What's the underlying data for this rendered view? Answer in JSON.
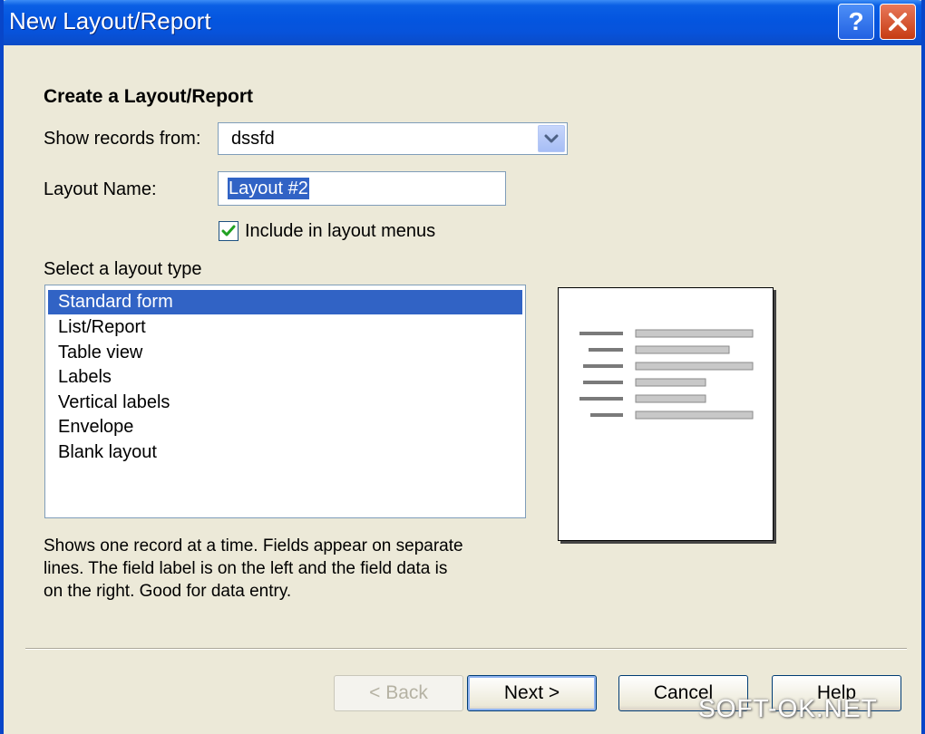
{
  "window": {
    "title": "New Layout/Report",
    "help_button": "?",
    "close_button": "X"
  },
  "form": {
    "heading": "Create a Layout/Report",
    "show_records_label": "Show records from:",
    "show_records_value": "dssfd",
    "layout_name_label": "Layout Name:",
    "layout_name_value": "Layout #2",
    "include_menus_label": "Include in layout menus",
    "include_menus_checked": true,
    "layout_type_label": "Select a layout type"
  },
  "layout_types": [
    {
      "label": "Standard form",
      "selected": true
    },
    {
      "label": "List/Report",
      "selected": false
    },
    {
      "label": "Table view",
      "selected": false
    },
    {
      "label": "Labels",
      "selected": false
    },
    {
      "label": "Vertical labels",
      "selected": false
    },
    {
      "label": "Envelope",
      "selected": false
    },
    {
      "label": "Blank layout",
      "selected": false
    }
  ],
  "description": {
    "line1": "Shows one record at a time. Fields appear on separate",
    "line2": "lines.  The field label is on the left and the field data is",
    "line3": "on the right.  Good for data entry."
  },
  "buttons": {
    "back": "< Back",
    "next": "Next >",
    "cancel": "Cancel",
    "help": "Help"
  },
  "watermark": "SOFT-OK.NET",
  "colors": {
    "titlebar": "#0455df",
    "dialog_bg": "#ece9d8",
    "selection": "#3163c5"
  }
}
